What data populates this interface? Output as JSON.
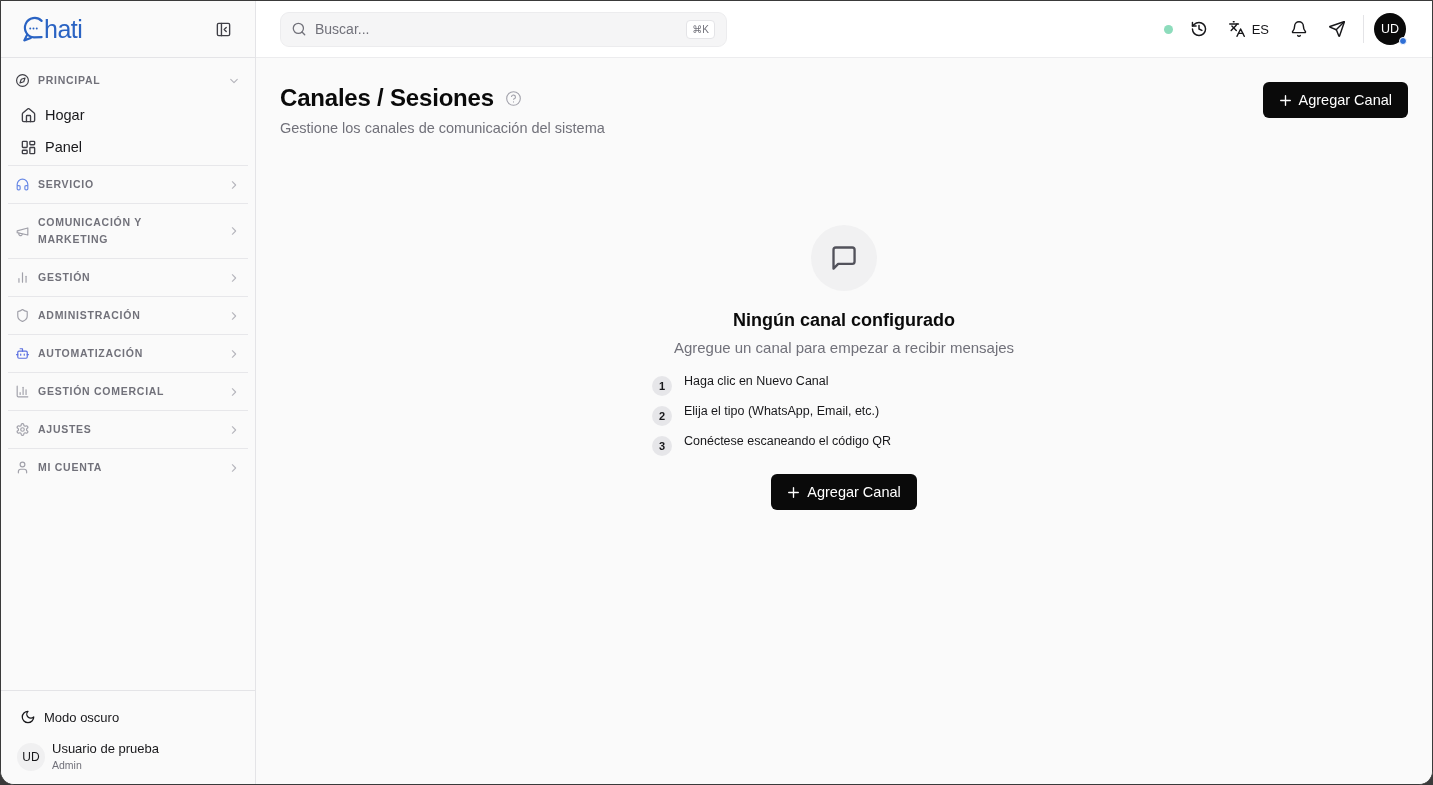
{
  "sidebar": {
    "logo": "hati",
    "sections": [
      {
        "label": "PRINCIPAL",
        "expanded": true,
        "children": [
          {
            "label": "Hogar"
          },
          {
            "label": "Panel"
          }
        ]
      },
      {
        "label": "SERVICIO",
        "expanded": false
      },
      {
        "label": "COMUNICACIÓN Y MARKETING",
        "expanded": false
      },
      {
        "label": "GESTIÓN",
        "expanded": false
      },
      {
        "label": "ADMINISTRACIÓN",
        "expanded": false
      },
      {
        "label": "AUTOMATIZACIÓN",
        "expanded": false
      },
      {
        "label": "GESTIÓN COMERCIAL",
        "expanded": false
      },
      {
        "label": "AJUSTES",
        "expanded": false
      },
      {
        "label": "MI CUENTA",
        "expanded": false
      }
    ],
    "dark_mode": "Modo oscuro",
    "user": {
      "initials": "UD",
      "name": "Usuario de prueba",
      "role": "Admin"
    }
  },
  "topbar": {
    "search": {
      "placeholder": "Buscar...",
      "shortcut": "⌘K"
    },
    "language": "ES",
    "avatar": "UD"
  },
  "page": {
    "title": "Canales / Sesiones",
    "subtitle": "Gestione los canales de comunicación del sistema",
    "add_button": "Agregar Canal",
    "empty_state": {
      "title": "Ningún canal configurado",
      "description": "Agregue un canal para empezar a recibir mensajes",
      "steps": [
        {
          "number": "1",
          "text": "Haga clic en Nuevo Canal"
        },
        {
          "number": "2",
          "text": "Elija el tipo (WhatsApp, Email, etc.)"
        },
        {
          "number": "3",
          "text": "Conéctese escaneando el código QR"
        }
      ],
      "button": "Agregar Canal"
    }
  }
}
